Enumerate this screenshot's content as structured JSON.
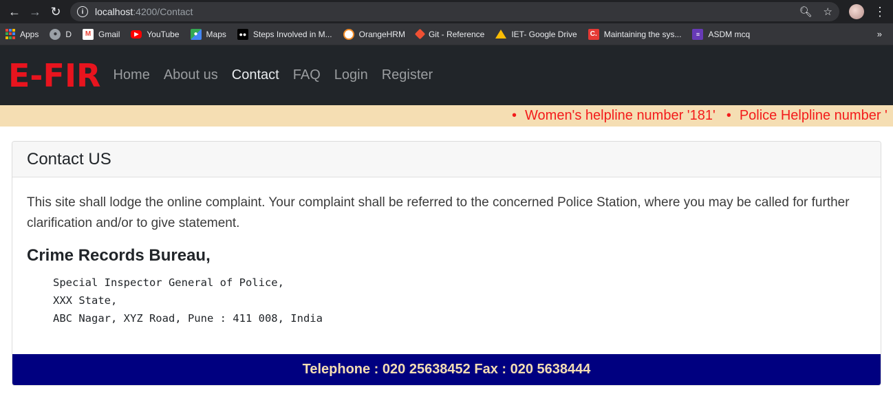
{
  "browser": {
    "url_host": "localhost",
    "url_path": ":4200/Contact",
    "bookmarks": [
      {
        "label": "Apps",
        "icon": "apps-grid-icon",
        "color": "#ea4335"
      },
      {
        "label": "D",
        "icon": "globe-icon",
        "color": "#9aa0a6"
      },
      {
        "label": "Gmail",
        "icon": "gmail-icon",
        "color": "#ea4335"
      },
      {
        "label": "YouTube",
        "icon": "youtube-icon",
        "color": "#ff0000"
      },
      {
        "label": "Maps",
        "icon": "maps-icon",
        "color": "#34a853"
      },
      {
        "label": "Steps Involved in M...",
        "icon": "medium-icon",
        "color": "#000000"
      },
      {
        "label": "OrangeHRM",
        "icon": "orangehrm-icon",
        "color": "#f28c28"
      },
      {
        "label": "Git - Reference",
        "icon": "git-icon",
        "color": "#f05033"
      },
      {
        "label": "IET- Google Drive",
        "icon": "google-drive-icon",
        "color": "#fbbc04"
      },
      {
        "label": "Maintaining the sys...",
        "icon": "c-logo-icon",
        "color": "#e53935"
      },
      {
        "label": "ASDM mcq",
        "icon": "forms-icon",
        "color": "#673ab7"
      }
    ],
    "more": "»"
  },
  "navbar": {
    "brand": "E-FIR",
    "links": [
      "Home",
      "About us",
      "Contact",
      "FAQ",
      "Login",
      "Register"
    ],
    "active": "Contact"
  },
  "marquee": {
    "items": [
      "Women's helpline number '181'",
      "Police Helpline number '"
    ]
  },
  "card": {
    "title": "Contact US",
    "intro": "This site shall lodge the online complaint. Your complaint shall be referred to the concerned Police Station, where you may be called for further clarification and/or to give statement.",
    "bureau": "Crime Records Bureau,",
    "address_lines": [
      "Special Inspector General of Police,",
      "XXX State,",
      "ABC Nagar, XYZ Road, Pune : 411 008, India"
    ],
    "footer": "Telephone : 020 25638452 Fax : 020 5638444"
  },
  "colors": {
    "brand": "#e8141e",
    "navbar_bg": "#212529",
    "marquee_bg": "#f5deb3",
    "marquee_text": "#f31b1b",
    "footer_bg": "#000080",
    "footer_text": "#f5deb3"
  }
}
